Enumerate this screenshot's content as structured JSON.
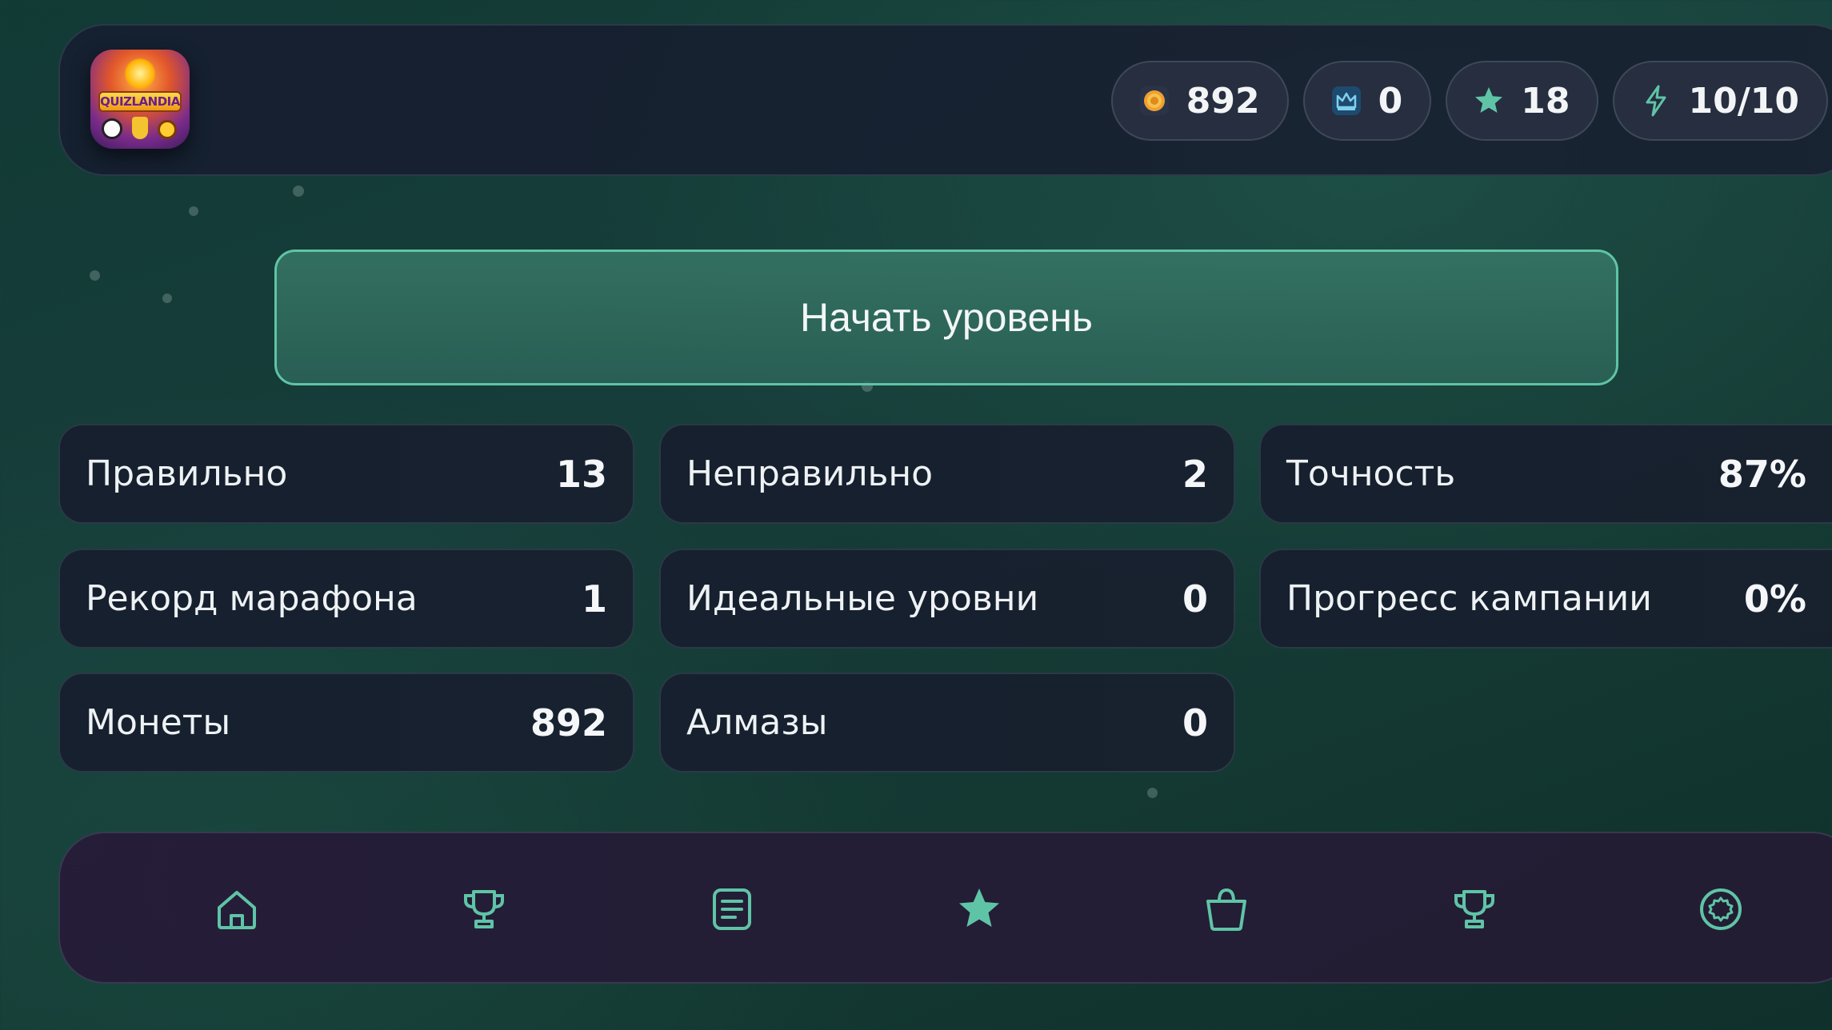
{
  "app": {
    "logo_text": "QUIZLANDIA"
  },
  "header": {
    "currencies": [
      {
        "name": "coins",
        "icon": "coin-icon",
        "value": "892"
      },
      {
        "name": "diamonds",
        "icon": "crown-gem-icon",
        "value": "0"
      },
      {
        "name": "stars",
        "icon": "star-icon",
        "value": "18"
      },
      {
        "name": "energy",
        "icon": "lightning-icon",
        "value": "10/10"
      }
    ]
  },
  "main": {
    "start_label": "Начать уровень",
    "stats": [
      {
        "label": "Правильно",
        "value": "13"
      },
      {
        "label": "Неправильно",
        "value": "2"
      },
      {
        "label": "Точность",
        "value": "87%"
      },
      {
        "label": "Рекорд марафона",
        "value": "1"
      },
      {
        "label": "Идеальные уровни",
        "value": "0"
      },
      {
        "label": "Прогресс кампании",
        "value": "0%"
      },
      {
        "label": "Монеты",
        "value": "892"
      },
      {
        "label": "Алмазы",
        "value": "0"
      }
    ]
  },
  "nav": {
    "items": [
      {
        "icon": "home-icon",
        "active": false
      },
      {
        "icon": "trophy-icon",
        "active": false
      },
      {
        "icon": "list-icon",
        "active": false
      },
      {
        "icon": "star-icon",
        "active": true
      },
      {
        "icon": "shopping-bag-icon",
        "active": false
      },
      {
        "icon": "trophy-icon",
        "active": false
      },
      {
        "icon": "settings-icon",
        "active": false
      }
    ]
  },
  "colors": {
    "accent": "#5fc4a6",
    "background": "#143832",
    "card": "#18202e"
  }
}
